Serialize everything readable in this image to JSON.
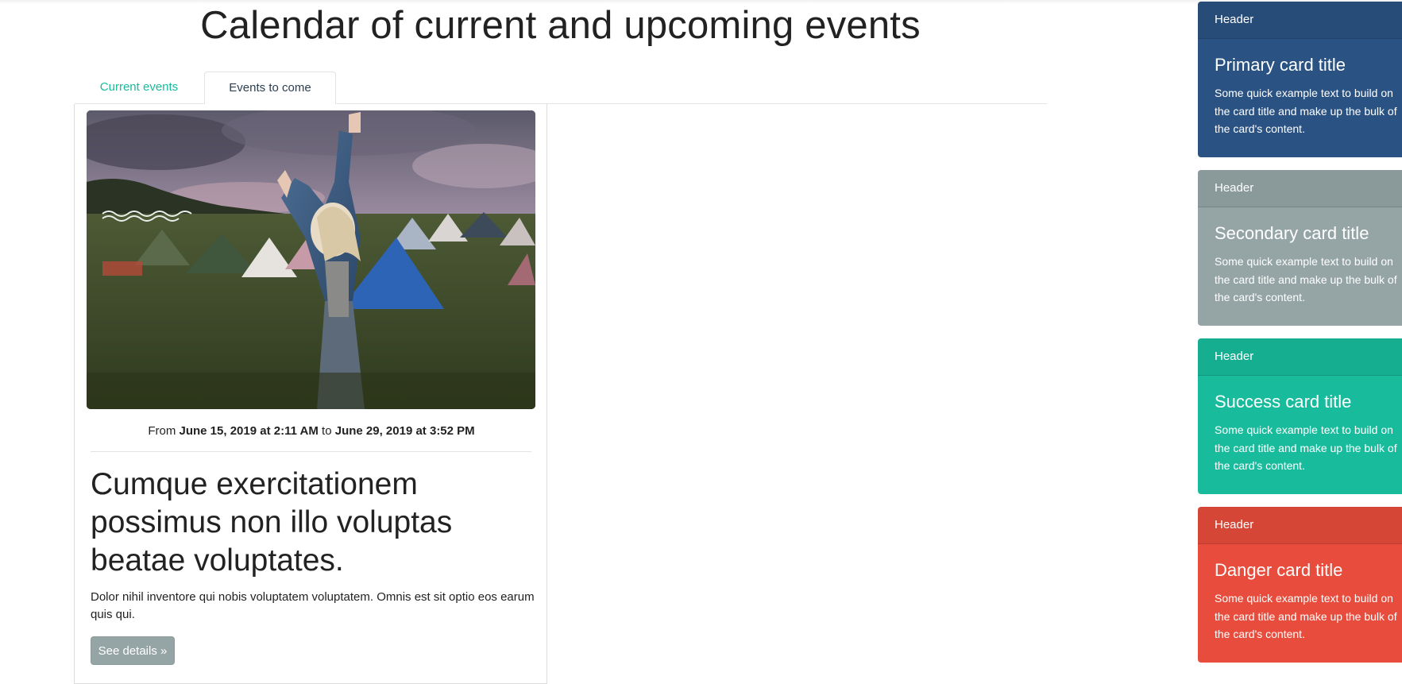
{
  "page": {
    "title": "Calendar of current and upcoming events"
  },
  "tabs": [
    {
      "label": "Current events",
      "active": false
    },
    {
      "label": "Events to come",
      "active": true
    }
  ],
  "event": {
    "image_alt": "Woman dancing with raised arms at a campsite festival with tents",
    "dates": {
      "from_word": "From",
      "start": "June 15, 2019 at 2:11 AM",
      "to_word": "to",
      "end": "June 29, 2019 at 3:52 PM"
    },
    "title": "Cumque exercitationem possimus non illo voluptas beatae voluptates.",
    "description": "Dolor nihil inventore qui nobis voluptatem voluptatem. Omnis est sit optio eos earum quis qui.",
    "details_button": "See details »"
  },
  "side_cards": [
    {
      "header": "Header",
      "title": "Primary card title",
      "text": "Some quick example text to build on the card title and make up the bulk of the card's content.",
      "color": "#2a5282"
    },
    {
      "header": "Header",
      "title": "Secondary card title",
      "text": "Some quick example text to build on the card title and make up the bulk of the card's content.",
      "color": "#95a5a6"
    },
    {
      "header": "Header",
      "title": "Success card title",
      "text": "Some quick example text to build on the card title and make up the bulk of the card's content.",
      "color": "#18bc9c"
    },
    {
      "header": "Header",
      "title": "Danger card title",
      "text": "Some quick example text to build on the card title and make up the bulk of the card's content.",
      "color": "#e74c3c"
    }
  ],
  "colors": {
    "accent": "#18bc9c",
    "text_dark": "#2c3e50",
    "button_secondary": "#95a5a6"
  }
}
